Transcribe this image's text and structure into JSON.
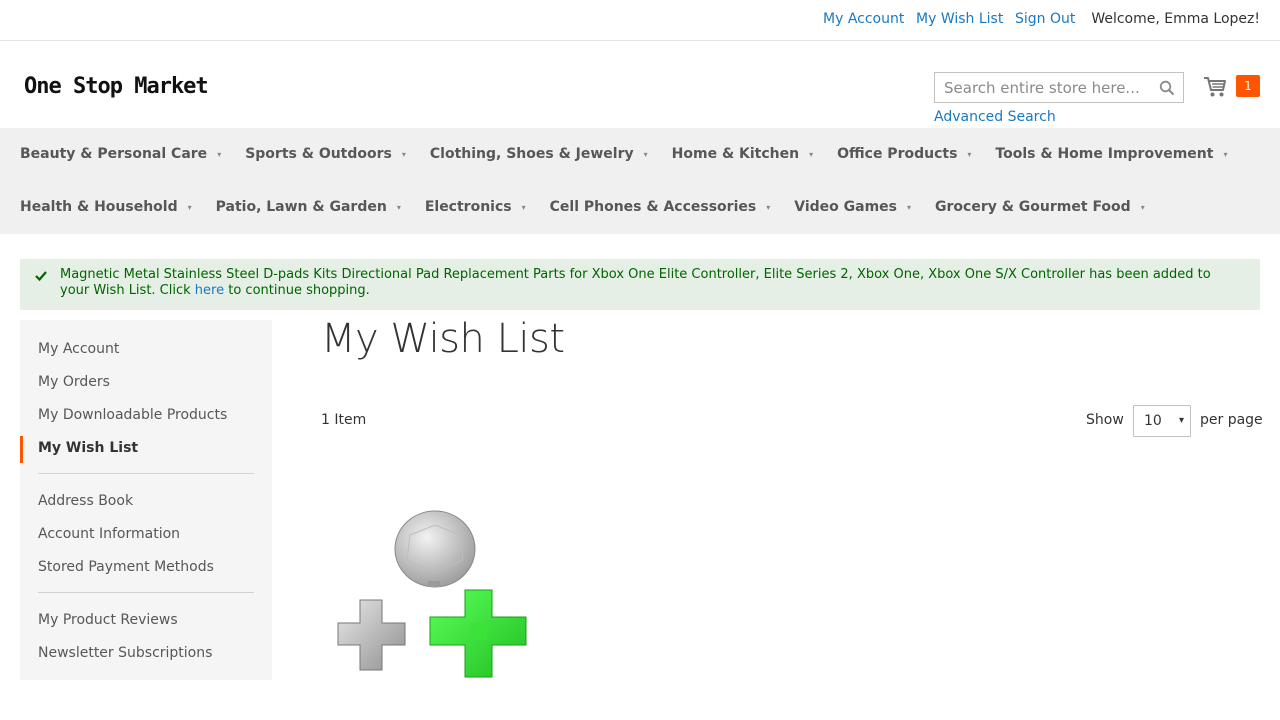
{
  "top_links": {
    "my_account": "My Account",
    "my_wish_list": "My Wish List",
    "sign_out": "Sign Out",
    "welcome": "Welcome, Emma Lopez!"
  },
  "header": {
    "logo_text": "One Stop Market",
    "search_placeholder": "Search entire store here...",
    "advanced_search": "Advanced Search",
    "cart_count": "1"
  },
  "nav": {
    "row1": [
      "Beauty & Personal Care",
      "Sports & Outdoors",
      "Clothing, Shoes & Jewelry",
      "Home & Kitchen",
      "Office Products",
      "Tools & Home Improvement"
    ],
    "row2": [
      "Health & Household",
      "Patio, Lawn & Garden",
      "Electronics",
      "Cell Phones & Accessories",
      "Video Games",
      "Grocery & Gourmet Food"
    ]
  },
  "message": {
    "text": "Magnetic Metal Stainless Steel D-pads Kits Directional Pad Replacement Parts for Xbox One Elite Controller, Elite Series 2, Xbox One, Xbox One S/X Controller has been added to your Wish List. Click",
    "link": "here",
    "suffix": "to continue shopping."
  },
  "sidebar": {
    "group1": [
      "My Account",
      "My Orders",
      "My Downloadable Products",
      "My Wish List"
    ],
    "group2": [
      "Address Book",
      "Account Information",
      "Stored Payment Methods"
    ],
    "group3": [
      "My Product Reviews",
      "Newsletter Subscriptions"
    ],
    "active": "My Wish List"
  },
  "main": {
    "title": "My Wish List",
    "item_count": "1 Item",
    "show_label": "Show",
    "per_page_value": "10",
    "per_page_label": "per page"
  },
  "colors": {
    "link": "#1979c3",
    "accent": "#ff5501",
    "success_bg": "#e5efe5",
    "success_text": "#006400"
  }
}
